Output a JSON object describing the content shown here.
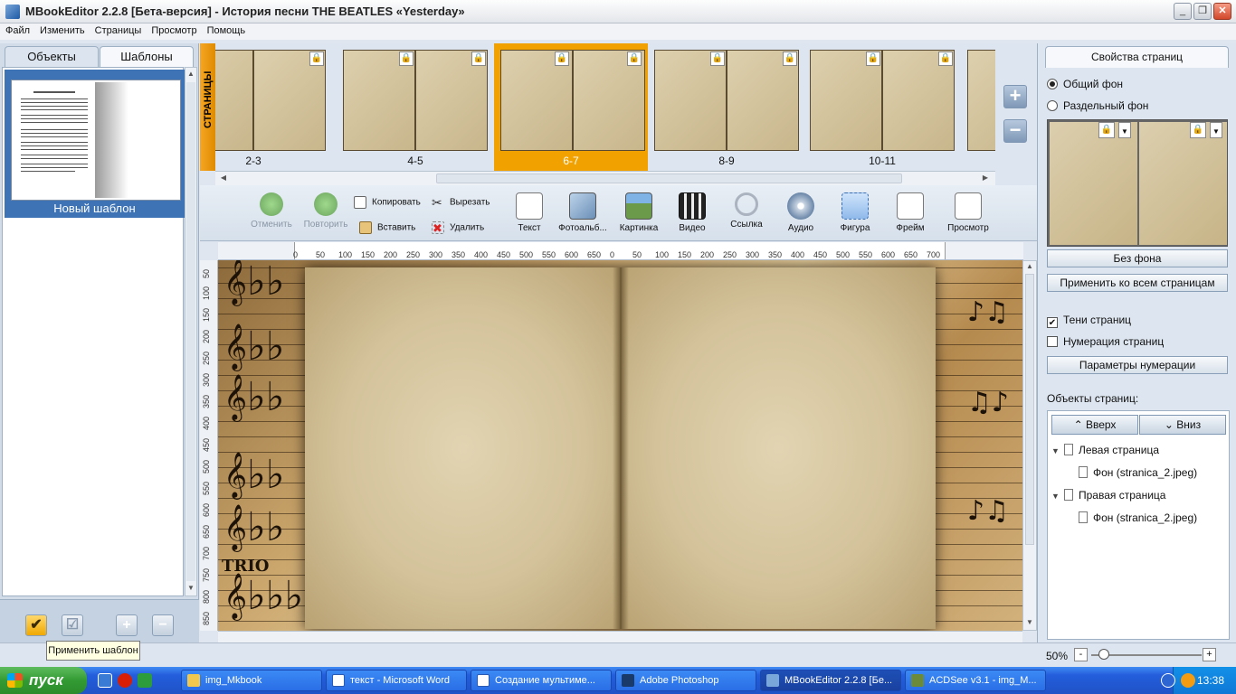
{
  "window": {
    "title": "MBookEditor 2.2.8 [Бета-версия] - История песни THE BEATLES «Yesterday»",
    "controls": {
      "minimize": "_",
      "maximize": "❐",
      "close": "✕"
    }
  },
  "menu": [
    "Файл",
    "Изменить",
    "Страницы",
    "Просмотр",
    "Помощь"
  ],
  "left_panel": {
    "tabs": [
      "Объекты",
      "Шаблоны"
    ],
    "active_tab": "Шаблоны",
    "template_label": "Новый шаблон",
    "tooltip": "Применить шаблон",
    "bottom_buttons": {
      "apply": "✔",
      "apply2": "☑",
      "add": "+",
      "remove": "−"
    }
  },
  "pages": {
    "strip_label": "СТРАНИЦЫ",
    "spreads": [
      "2-3",
      "4-5",
      "6-7",
      "8-9",
      "10-11"
    ],
    "selected": "6-7",
    "lock_glyph": "🔒",
    "add": "+",
    "remove": "−"
  },
  "toolbar": {
    "undo": "Отменить",
    "redo": "Повторить",
    "copy": "Копировать",
    "paste": "Вставить",
    "cut": "Вырезать",
    "delete": "Удалить",
    "text": "Текст",
    "photoalbum": "Фотоальб...",
    "picture": "Картинка",
    "video": "Видео",
    "link": "Ссылка",
    "audio": "Аудио",
    "shape": "Фигура",
    "frame": "Фрейм",
    "preview": "Просмотр"
  },
  "ruler": {
    "h_ticks": [
      "0",
      "50",
      "100",
      "150",
      "200",
      "250",
      "300",
      "350",
      "400",
      "450",
      "500",
      "550",
      "600",
      "650",
      "0",
      "50",
      "100",
      "150",
      "200",
      "250",
      "300",
      "350",
      "400",
      "450",
      "500",
      "550",
      "600",
      "650",
      "700"
    ],
    "v_ticks": [
      "50",
      "100",
      "150",
      "200",
      "250",
      "300",
      "350",
      "400",
      "450",
      "500",
      "550",
      "600",
      "650",
      "700",
      "750",
      "800",
      "850"
    ]
  },
  "canvas": {
    "trio_text": "TRIO"
  },
  "right_panel": {
    "tab": "Свойства страниц",
    "bg_common": "Общий фон",
    "bg_separate": "Раздельный фон",
    "no_bg": "Без фона",
    "apply_all": "Применить ко всем страницам",
    "page_shadows": "Тени страниц",
    "page_numbering": "Нумерация страниц",
    "numbering_params": "Параметры нумерации",
    "objects_label": "Объекты страниц:",
    "up": "Вверх",
    "down": "Вниз",
    "tree": {
      "left": "Левая страница",
      "left_bg": "Фон (stranica_2.jpeg)",
      "right": "Правая страница",
      "right_bg": "Фон (stranica_2.jpeg)"
    }
  },
  "statusbar": {
    "zoom": "50%",
    "minus": "-",
    "plus": "+"
  },
  "taskbar": {
    "start": "пуск",
    "tasks": [
      "img_Mkbook",
      "текст - Microsoft Word",
      "Создание мультиме...",
      "Adobe Photoshop",
      "MBookEditor 2.2.8 [Бе...",
      "ACDSee v3.1 - img_M..."
    ],
    "clock": "13:38"
  }
}
